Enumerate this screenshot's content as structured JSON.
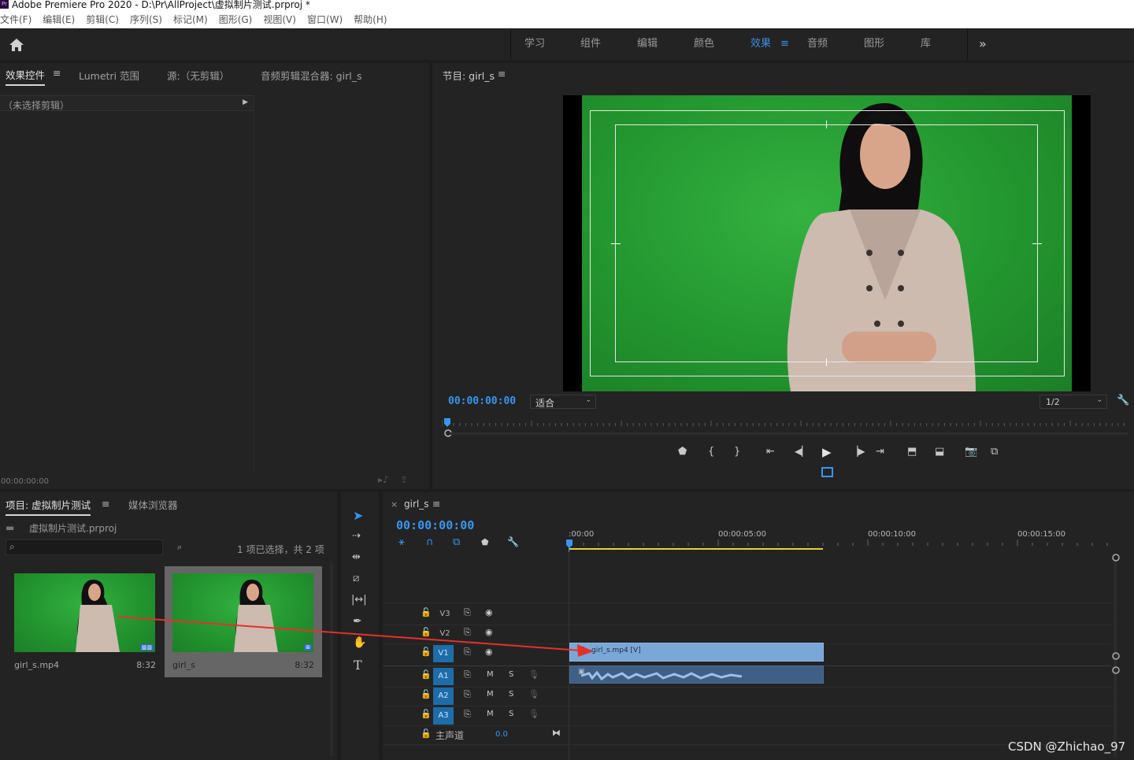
{
  "app": {
    "title": "Adobe Premiere Pro 2020 - D:\\Pr\\AllProject\\虚拟制片测试.prproj *",
    "logo": "Pr"
  },
  "menu": [
    "文件(F)",
    "编辑(E)",
    "剪辑(C)",
    "序列(S)",
    "标记(M)",
    "图形(G)",
    "视图(V)",
    "窗口(W)",
    "帮助(H)"
  ],
  "workspaces": {
    "home_icon": "home-icon",
    "items": [
      "学习",
      "组件",
      "编辑",
      "颜色",
      "效果",
      "音频",
      "图形",
      "库"
    ],
    "active": "效果",
    "more": "»",
    "menu_glyph": "≡"
  },
  "source_panel": {
    "tabs": [
      "效果控件",
      "Lumetri 范围",
      "源:（无剪辑）",
      "音频剪辑混合器: girl_s"
    ],
    "menu_glyph": "≡",
    "no_clip": "（未选择剪辑）",
    "timecode": "00:00:00:00"
  },
  "program": {
    "title": "节目: girl_s",
    "menu_glyph": "≡",
    "timecode": "00:00:00:00",
    "fit": "适合",
    "resolution": "1/2",
    "playhead": 0
  },
  "project": {
    "tabs": [
      "项目: 虚拟制片测试",
      "媒体浏览器"
    ],
    "menu_glyph": "≡",
    "filename": "虚拟制片测试.prproj",
    "search_placeholder": "",
    "count": "1 项已选择，共 2 项",
    "items": [
      {
        "name": "girl_s.mp4",
        "duration": "8:32",
        "selected": false
      },
      {
        "name": "girl_s",
        "duration": "8:32",
        "selected": true
      }
    ]
  },
  "timeline": {
    "tab": "girl_s",
    "close": "×",
    "menu_glyph": "≡",
    "timecode": "00:00:00:00",
    "ruler": [
      ":00:00",
      "00:00:05:00",
      "00:00:10:00",
      "00:00:15:00"
    ],
    "tracks": [
      {
        "name": "V3",
        "type": "video"
      },
      {
        "name": "V2",
        "type": "video"
      },
      {
        "name": "V1",
        "type": "video",
        "selected": true
      },
      {
        "name": "A1",
        "type": "audio",
        "selected": true
      },
      {
        "name": "A2",
        "type": "audio",
        "selected": true
      },
      {
        "name": "A3",
        "type": "audio",
        "selected": true
      }
    ],
    "mute": "M",
    "solo": "S",
    "master_label": "主声道",
    "master_value": "0.0",
    "clip_label": "girl_s.mp4 [V]"
  },
  "tools": [
    "selection-tool",
    "track-select-tool",
    "ripple-edit-tool",
    "razor-tool",
    "slip-tool",
    "pen-tool",
    "hand-tool",
    "type-tool"
  ],
  "watermark": "CSDN @Zhichao_97",
  "colors": {
    "accent": "#3d8fe6",
    "clip_video": "#7aa7d8",
    "clip_audio": "#3f5f86",
    "green_screen": "#27a033",
    "track_select": "#1d6da8",
    "work_area": "#e2d13a"
  }
}
